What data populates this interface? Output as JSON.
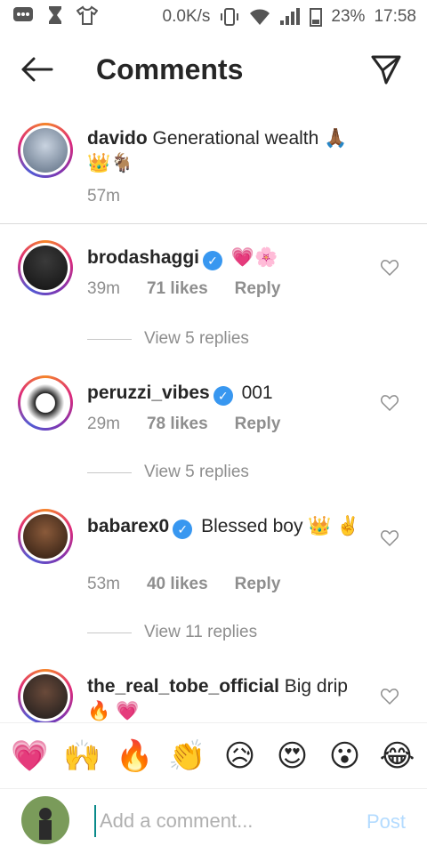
{
  "statusbar": {
    "speed": "0.0K/s",
    "battery": "23%",
    "time": "17:58"
  },
  "header": {
    "title": "Comments"
  },
  "caption": {
    "username": "davido",
    "text": "Generational wealth 🙏🏾 👑🐐",
    "time": "57m"
  },
  "comments": [
    {
      "username": "brodashaggi",
      "text": "💗🌸",
      "time": "39m",
      "likes": "71 likes",
      "reply": "Reply",
      "view_replies": "View 5 replies"
    },
    {
      "username": "peruzzi_vibes",
      "text": "001",
      "time": "29m",
      "likes": "78 likes",
      "reply": "Reply",
      "view_replies": "View 5 replies"
    },
    {
      "username": "babarex0",
      "text": "Blessed boy 👑 ✌️",
      "time": "53m",
      "likes": "40 likes",
      "reply": "Reply",
      "view_replies": "View 11 replies"
    },
    {
      "username": "the_real_tobe_official",
      "text": "Big drip🔥 💗"
    }
  ],
  "emoji_bar": [
    "💗",
    "🙌",
    "🔥",
    "👏",
    "😥",
    "😍",
    "😮",
    "😂"
  ],
  "composer": {
    "placeholder": "Add a comment...",
    "post_label": "Post"
  }
}
